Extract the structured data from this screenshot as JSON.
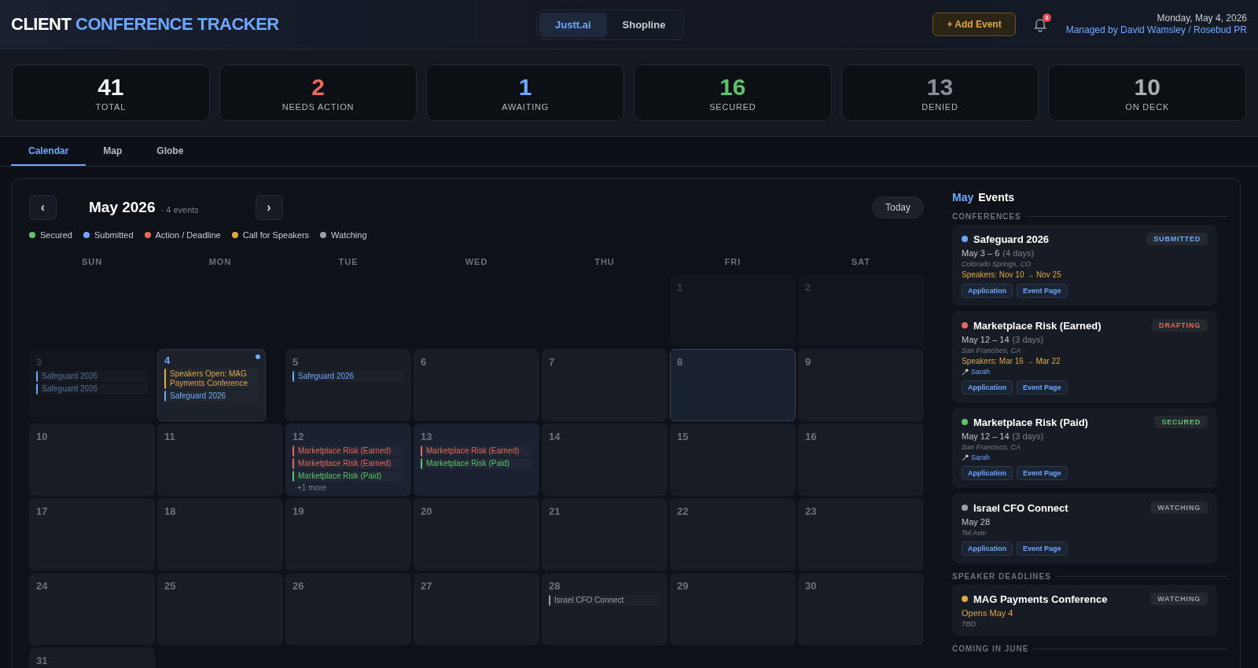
{
  "header": {
    "title_lead": "CLIENT",
    "title_accent": "CONFERENCE TRACKER",
    "clients": [
      {
        "label": "Justt.ai",
        "selected": true
      },
      {
        "label": "Shopline",
        "selected": false
      }
    ],
    "add_button": "+ Add Event",
    "notification_count": "3",
    "date": "Monday, May 4, 2026",
    "managed_by": "Managed by David Wamsley / Rosebud PR"
  },
  "stats": [
    {
      "value": "41",
      "label": "TOTAL",
      "color": "#f2f4f7"
    },
    {
      "value": "2",
      "label": "NEEDS ACTION",
      "color": "#e8685a"
    },
    {
      "value": "1",
      "label": "AWAITING",
      "color": "#6ea8fe"
    },
    {
      "value": "16",
      "label": "SECURED",
      "color": "#5cc46a"
    },
    {
      "value": "13",
      "label": "DENIED",
      "color": "#8a8f98"
    },
    {
      "value": "10",
      "label": "ON DECK",
      "color": "#a9adb4"
    }
  ],
  "tabs": [
    {
      "label": "Calendar",
      "selected": true
    },
    {
      "label": "Map",
      "selected": false
    },
    {
      "label": "Globe",
      "selected": false
    }
  ],
  "calendar": {
    "prev": "‹",
    "month": "May 2026",
    "count": "· 4 events",
    "next": "›",
    "today_button": "Today",
    "legend": [
      {
        "label": "Secured",
        "color": "#5cc46a"
      },
      {
        "label": "Submitted",
        "color": "#6ea8fe"
      },
      {
        "label": "Action / Deadline",
        "color": "#e8685a"
      },
      {
        "label": "Call for Speakers",
        "color": "#e0a840"
      },
      {
        "label": "Watching",
        "color": "#9aa0a6"
      }
    ],
    "weekdays": [
      "SUN",
      "MON",
      "TUE",
      "WED",
      "THU",
      "FRI",
      "SAT"
    ],
    "weeks": [
      [
        {
          "kind": "blank"
        },
        {
          "kind": "blank"
        },
        {
          "kind": "blank"
        },
        {
          "kind": "blank"
        },
        {
          "kind": "blank"
        },
        {
          "kind": "day",
          "day": "1",
          "past": true,
          "today": false,
          "selected": false
        },
        {
          "kind": "day",
          "day": "2",
          "past": true,
          "today": false,
          "selected": false
        }
      ],
      [
        {
          "kind": "day",
          "day": "3",
          "past": true,
          "today": false,
          "selected": false,
          "events": [
            {
              "label": "Safeguard 2026",
              "color": "#6ea8fe"
            },
            {
              "label": "Safeguard 2026",
              "color": "#6ea8fe"
            }
          ]
        },
        {
          "kind": "day",
          "day": "4",
          "past": false,
          "today": true,
          "selected": false,
          "events": [
            {
              "label": "Speakers Open: MAG Payments Conference",
              "color": "#e0a840"
            },
            {
              "label": "Safeguard 2026",
              "color": "#6ea8fe"
            }
          ]
        },
        {
          "kind": "day",
          "day": "5",
          "past": false,
          "today": false,
          "selected": false,
          "events": [
            {
              "label": "Safeguard 2026",
              "color": "#6ea8fe"
            }
          ]
        },
        {
          "kind": "day",
          "day": "6",
          "past": false,
          "today": false,
          "selected": false
        },
        {
          "kind": "day",
          "day": "7",
          "past": false,
          "today": false,
          "selected": false
        },
        {
          "kind": "day",
          "day": "8",
          "past": false,
          "today": false,
          "selected": true
        },
        {
          "kind": "day",
          "day": "9",
          "past": false,
          "today": false,
          "selected": false
        }
      ],
      [
        {
          "kind": "day",
          "day": "10",
          "past": false,
          "today": false,
          "selected": false
        },
        {
          "kind": "day",
          "day": "11",
          "past": false,
          "today": false,
          "selected": false
        },
        {
          "kind": "day",
          "day": "12",
          "past": false,
          "today": false,
          "selected": false,
          "events": [
            {
              "label": "Marketplace Risk (Earned)",
              "color": "#e8685a"
            },
            {
              "label": "Marketplace Risk (Earned)",
              "color": "#e8685a"
            },
            {
              "label": "Marketplace Risk (Paid)",
              "color": "#5cc46a"
            }
          ],
          "more": "+1 more"
        },
        {
          "kind": "day",
          "day": "13",
          "past": false,
          "today": false,
          "selected": false,
          "events": [
            {
              "label": "Marketplace Risk (Earned)",
              "color": "#e8685a"
            },
            {
              "label": "Marketplace Risk (Paid)",
              "color": "#5cc46a"
            }
          ]
        },
        {
          "kind": "day",
          "day": "14",
          "past": false,
          "today": false,
          "selected": false
        },
        {
          "kind": "day",
          "day": "15",
          "past": false,
          "today": false,
          "selected": false
        },
        {
          "kind": "day",
          "day": "16",
          "past": false,
          "today": false,
          "selected": false
        }
      ],
      [
        {
          "kind": "day",
          "day": "17",
          "past": false,
          "today": false,
          "selected": false
        },
        {
          "kind": "day",
          "day": "18",
          "past": false,
          "today": false,
          "selected": false
        },
        {
          "kind": "day",
          "day": "19",
          "past": false,
          "today": false,
          "selected": false
        },
        {
          "kind": "day",
          "day": "20",
          "past": false,
          "today": false,
          "selected": false
        },
        {
          "kind": "day",
          "day": "21",
          "past": false,
          "today": false,
          "selected": false
        },
        {
          "kind": "day",
          "day": "22",
          "past": false,
          "today": false,
          "selected": false
        },
        {
          "kind": "day",
          "day": "23",
          "past": false,
          "today": false,
          "selected": false
        }
      ],
      [
        {
          "kind": "day",
          "day": "24",
          "past": false,
          "today": false,
          "selected": false
        },
        {
          "kind": "day",
          "day": "25",
          "past": false,
          "today": false,
          "selected": false
        },
        {
          "kind": "day",
          "day": "26",
          "past": false,
          "today": false,
          "selected": false
        },
        {
          "kind": "day",
          "day": "27",
          "past": false,
          "today": false,
          "selected": false
        },
        {
          "kind": "day",
          "day": "28",
          "past": false,
          "today": false,
          "selected": false,
          "events": [
            {
              "label": "Israel CFO Connect",
              "color": "#9aa0a6"
            }
          ]
        },
        {
          "kind": "day",
          "day": "29",
          "past": false,
          "today": false,
          "selected": false
        },
        {
          "kind": "day",
          "day": "30",
          "past": false,
          "today": false,
          "selected": false
        }
      ],
      [
        {
          "kind": "day",
          "day": "31",
          "past": false,
          "today": false,
          "selected": false
        }
      ]
    ]
  },
  "events_panel": {
    "title_month": "May",
    "title_rest": "Events",
    "sections": [
      {
        "title": "CONFERENCES",
        "cards": [
          {
            "name": "Safeguard 2026",
            "color": "#6ea8fe",
            "badge": {
              "text": "SUBMITTED",
              "color": "#6ea8fe"
            },
            "dates": "May 3 – 6",
            "duration": "(4 days)",
            "location": "Colorado Springs, CO",
            "speakers": "Speakers: Nov 10 → Nov 25",
            "links": [
              "Application",
              "Event Page"
            ]
          },
          {
            "name": "Marketplace Risk (Earned)",
            "color": "#e8685a",
            "badge": {
              "text": "DRAFTING",
              "color": "#e8685a"
            },
            "dates": "May 12 – 14",
            "duration": "(3 days)",
            "location": "San Francisco, CA",
            "speakers": "Speakers: Mar 16 → Mar 22",
            "speaker_person": "Sarah",
            "links": [
              "Application",
              "Event Page"
            ]
          },
          {
            "name": "Marketplace Risk (Paid)",
            "color": "#5cc46a",
            "badge": {
              "text": "SECURED",
              "color": "#5cc46a"
            },
            "dates": "May 12 – 14",
            "duration": "(3 days)",
            "location": "San Francisco, CA",
            "speaker_person": "Sarah",
            "links": [
              "Application",
              "Event Page"
            ]
          },
          {
            "name": "Israel CFO Connect",
            "color": "#9aa0a6",
            "badge": {
              "text": "WATCHING",
              "color": "#9aa0a6"
            },
            "dates": "May 28",
            "location": "Tel Aviv",
            "links": [
              "Application",
              "Event Page"
            ]
          }
        ]
      },
      {
        "title": "SPEAKER DEADLINES",
        "cards": [
          {
            "name": "MAG Payments Conference",
            "color": "#e0a840",
            "badge": {
              "text": "WATCHING",
              "color": "#9aa0a6"
            },
            "opens": "Opens May 4",
            "location": "TBD"
          }
        ]
      },
      {
        "title": "COMING IN JUNE"
      }
    ]
  }
}
